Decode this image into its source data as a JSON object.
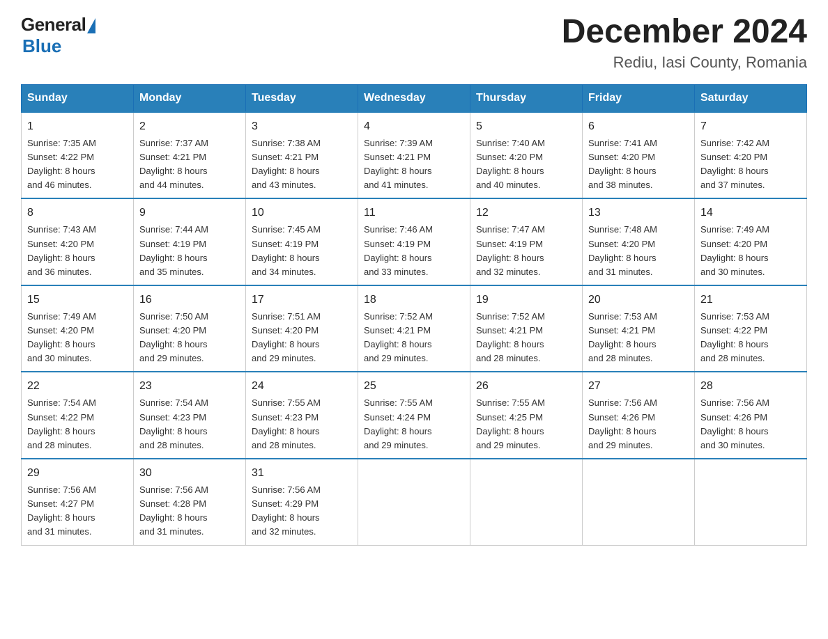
{
  "header": {
    "logo_general": "General",
    "logo_blue": "Blue",
    "month_year": "December 2024",
    "location": "Rediu, Iasi County, Romania"
  },
  "days_of_week": [
    "Sunday",
    "Monday",
    "Tuesday",
    "Wednesday",
    "Thursday",
    "Friday",
    "Saturday"
  ],
  "weeks": [
    [
      {
        "day": "1",
        "sunrise": "7:35 AM",
        "sunset": "4:22 PM",
        "daylight": "8 hours and 46 minutes."
      },
      {
        "day": "2",
        "sunrise": "7:37 AM",
        "sunset": "4:21 PM",
        "daylight": "8 hours and 44 minutes."
      },
      {
        "day": "3",
        "sunrise": "7:38 AM",
        "sunset": "4:21 PM",
        "daylight": "8 hours and 43 minutes."
      },
      {
        "day": "4",
        "sunrise": "7:39 AM",
        "sunset": "4:21 PM",
        "daylight": "8 hours and 41 minutes."
      },
      {
        "day": "5",
        "sunrise": "7:40 AM",
        "sunset": "4:20 PM",
        "daylight": "8 hours and 40 minutes."
      },
      {
        "day": "6",
        "sunrise": "7:41 AM",
        "sunset": "4:20 PM",
        "daylight": "8 hours and 38 minutes."
      },
      {
        "day": "7",
        "sunrise": "7:42 AM",
        "sunset": "4:20 PM",
        "daylight": "8 hours and 37 minutes."
      }
    ],
    [
      {
        "day": "8",
        "sunrise": "7:43 AM",
        "sunset": "4:20 PM",
        "daylight": "8 hours and 36 minutes."
      },
      {
        "day": "9",
        "sunrise": "7:44 AM",
        "sunset": "4:19 PM",
        "daylight": "8 hours and 35 minutes."
      },
      {
        "day": "10",
        "sunrise": "7:45 AM",
        "sunset": "4:19 PM",
        "daylight": "8 hours and 34 minutes."
      },
      {
        "day": "11",
        "sunrise": "7:46 AM",
        "sunset": "4:19 PM",
        "daylight": "8 hours and 33 minutes."
      },
      {
        "day": "12",
        "sunrise": "7:47 AM",
        "sunset": "4:19 PM",
        "daylight": "8 hours and 32 minutes."
      },
      {
        "day": "13",
        "sunrise": "7:48 AM",
        "sunset": "4:20 PM",
        "daylight": "8 hours and 31 minutes."
      },
      {
        "day": "14",
        "sunrise": "7:49 AM",
        "sunset": "4:20 PM",
        "daylight": "8 hours and 30 minutes."
      }
    ],
    [
      {
        "day": "15",
        "sunrise": "7:49 AM",
        "sunset": "4:20 PM",
        "daylight": "8 hours and 30 minutes."
      },
      {
        "day": "16",
        "sunrise": "7:50 AM",
        "sunset": "4:20 PM",
        "daylight": "8 hours and 29 minutes."
      },
      {
        "day": "17",
        "sunrise": "7:51 AM",
        "sunset": "4:20 PM",
        "daylight": "8 hours and 29 minutes."
      },
      {
        "day": "18",
        "sunrise": "7:52 AM",
        "sunset": "4:21 PM",
        "daylight": "8 hours and 29 minutes."
      },
      {
        "day": "19",
        "sunrise": "7:52 AM",
        "sunset": "4:21 PM",
        "daylight": "8 hours and 28 minutes."
      },
      {
        "day": "20",
        "sunrise": "7:53 AM",
        "sunset": "4:21 PM",
        "daylight": "8 hours and 28 minutes."
      },
      {
        "day": "21",
        "sunrise": "7:53 AM",
        "sunset": "4:22 PM",
        "daylight": "8 hours and 28 minutes."
      }
    ],
    [
      {
        "day": "22",
        "sunrise": "7:54 AM",
        "sunset": "4:22 PM",
        "daylight": "8 hours and 28 minutes."
      },
      {
        "day": "23",
        "sunrise": "7:54 AM",
        "sunset": "4:23 PM",
        "daylight": "8 hours and 28 minutes."
      },
      {
        "day": "24",
        "sunrise": "7:55 AM",
        "sunset": "4:23 PM",
        "daylight": "8 hours and 28 minutes."
      },
      {
        "day": "25",
        "sunrise": "7:55 AM",
        "sunset": "4:24 PM",
        "daylight": "8 hours and 29 minutes."
      },
      {
        "day": "26",
        "sunrise": "7:55 AM",
        "sunset": "4:25 PM",
        "daylight": "8 hours and 29 minutes."
      },
      {
        "day": "27",
        "sunrise": "7:56 AM",
        "sunset": "4:26 PM",
        "daylight": "8 hours and 29 minutes."
      },
      {
        "day": "28",
        "sunrise": "7:56 AM",
        "sunset": "4:26 PM",
        "daylight": "8 hours and 30 minutes."
      }
    ],
    [
      {
        "day": "29",
        "sunrise": "7:56 AM",
        "sunset": "4:27 PM",
        "daylight": "8 hours and 31 minutes."
      },
      {
        "day": "30",
        "sunrise": "7:56 AM",
        "sunset": "4:28 PM",
        "daylight": "8 hours and 31 minutes."
      },
      {
        "day": "31",
        "sunrise": "7:56 AM",
        "sunset": "4:29 PM",
        "daylight": "8 hours and 32 minutes."
      },
      null,
      null,
      null,
      null
    ]
  ],
  "labels": {
    "sunrise": "Sunrise:",
    "sunset": "Sunset:",
    "daylight": "Daylight:"
  }
}
